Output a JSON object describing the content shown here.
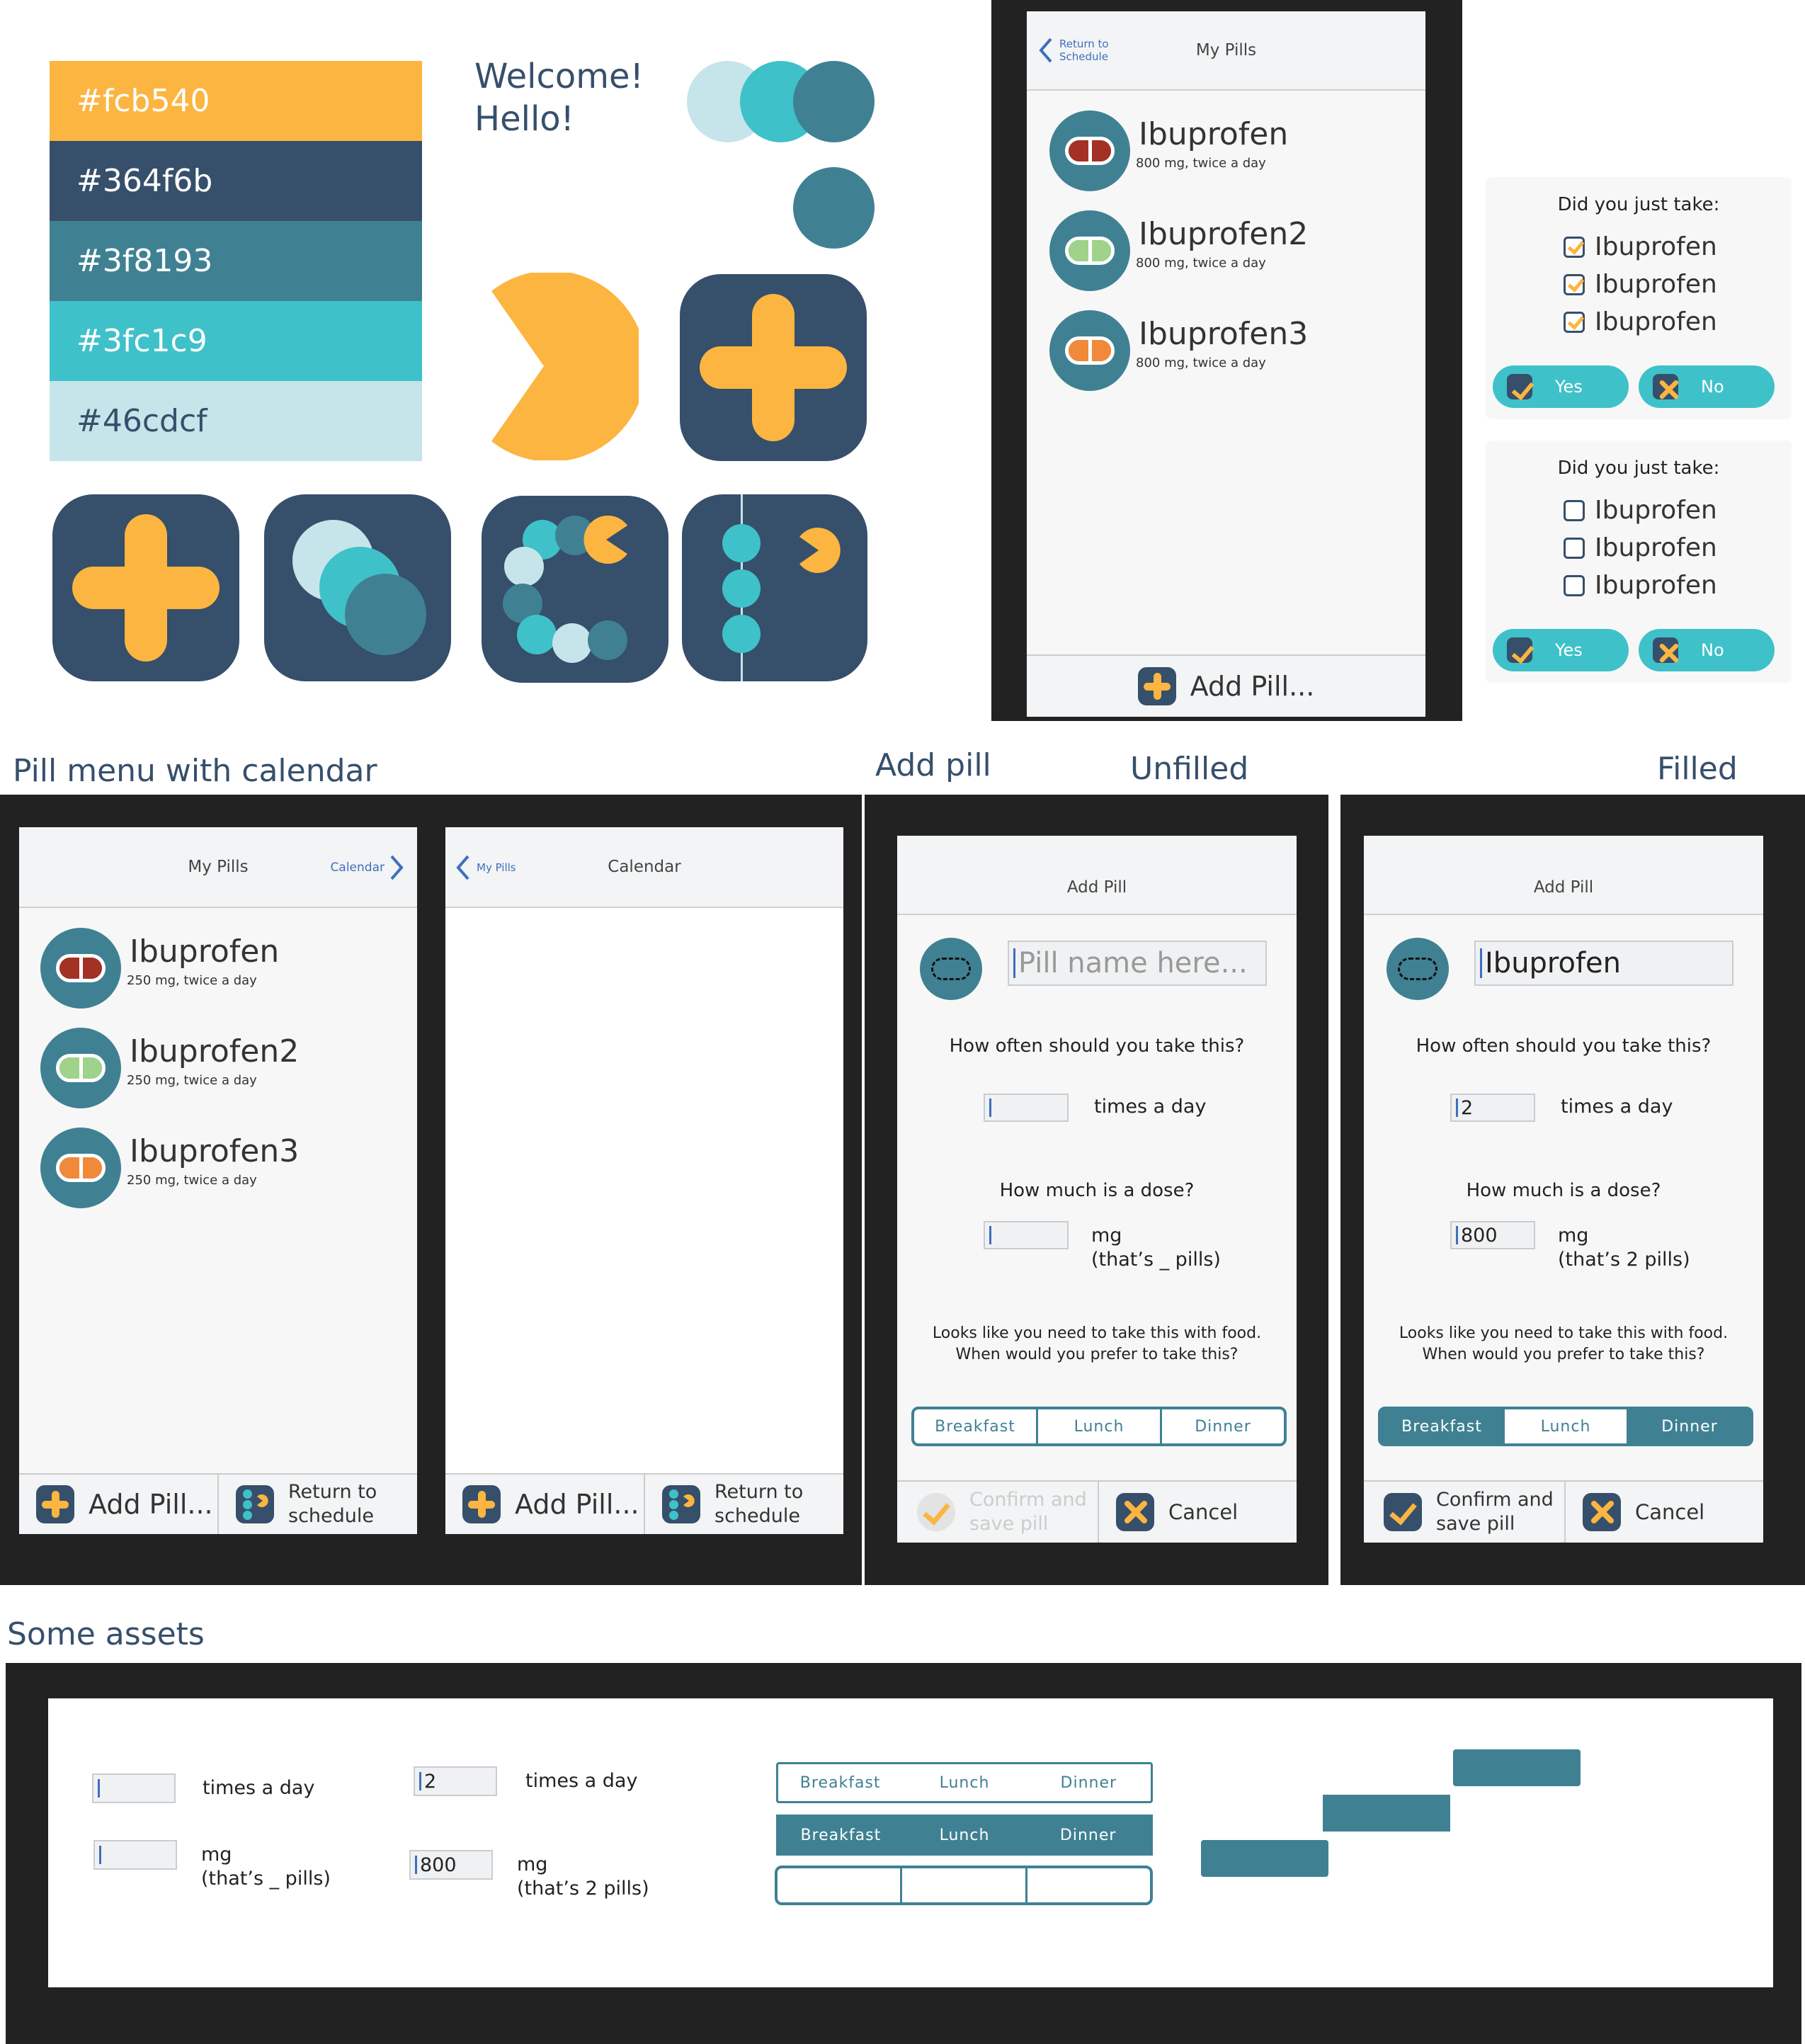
{
  "palette": {
    "swatches": [
      {
        "hex": "#fcb540",
        "label": "#fcb540",
        "text_color": "#ffffff"
      },
      {
        "hex": "#364f6b",
        "label": "#364f6b",
        "text_color": "#ffffff"
      },
      {
        "hex": "#3f8193",
        "label": "#3f8193",
        "text_color": "#ffffff"
      },
      {
        "hex": "#3fc1c9",
        "label": "#3fc1c9",
        "text_color": "#ffffff"
      },
      {
        "hex": "#c5e5ea",
        "label": "#46cdcf",
        "text_color": "#364f6b"
      }
    ]
  },
  "welcome": {
    "line1": "Welcome!",
    "line2": "Hello!"
  },
  "top_phone": {
    "back_label": "Return to Schedule",
    "title": "My Pills",
    "pills": [
      {
        "name": "Ibuprofen",
        "desc": "800 mg, twice a day",
        "color": "#a33224"
      },
      {
        "name": "Ibuprofen2",
        "desc": "800 mg, twice a day",
        "color": "#9fd28a"
      },
      {
        "name": "Ibuprofen3",
        "desc": "800 mg, twice a day",
        "color": "#f08a3a"
      }
    ],
    "add_label": "Add Pill..."
  },
  "prompts": [
    {
      "question": "Did you just take:",
      "items": [
        {
          "label": "Ibuprofen",
          "checked": true
        },
        {
          "label": "Ibuprofen",
          "checked": true
        },
        {
          "label": "Ibuprofen",
          "checked": true
        }
      ],
      "yes": "Yes",
      "no": "No"
    },
    {
      "question": "Did you just take:",
      "items": [
        {
          "label": "Ibuprofen",
          "checked": false
        },
        {
          "label": "Ibuprofen",
          "checked": false
        },
        {
          "label": "Ibuprofen",
          "checked": false
        }
      ],
      "yes": "Yes",
      "no": "No"
    }
  ],
  "sections": {
    "pill_menu": "Pill menu with calendar",
    "add_pill": "Add pill",
    "unfilled": "Unfilled",
    "filled": "Filled",
    "assets": "Some assets"
  },
  "menu_phone": {
    "title": "My Pills",
    "calendar_link": "Calendar",
    "pills": [
      {
        "name": "Ibuprofen",
        "desc": "250 mg, twice a day",
        "color": "#a33224"
      },
      {
        "name": "Ibuprofen2",
        "desc": "250 mg, twice a day",
        "color": "#9fd28a"
      },
      {
        "name": "Ibuprofen3",
        "desc": "250 mg, twice a day",
        "color": "#f08a3a"
      }
    ],
    "add_label": "Add Pill...",
    "return_label_1": "Return to",
    "return_label_2": "schedule"
  },
  "calendar_phone": {
    "back_label": "My Pills",
    "title": "Calendar",
    "add_label": "Add Pill...",
    "return_label_1": "Return to",
    "return_label_2": "schedule"
  },
  "add_unfilled": {
    "title": "Add Pill",
    "name_value": "",
    "name_placeholder": "Pill name here...",
    "freq_question": "How often should you take this?",
    "freq_value": "",
    "freq_unit": "times a day",
    "dose_question": "How much is a dose?",
    "dose_value": "",
    "dose_unit": "mg",
    "dose_note": "(that’s _ pills)",
    "food_line1": "Looks like you need to take this with food.",
    "food_line2": "When would you prefer to take this?",
    "meals": [
      "Breakfast",
      "Lunch",
      "Dinner"
    ],
    "confirm_1": "Confirm and",
    "confirm_2": "save pill",
    "cancel": "Cancel"
  },
  "add_filled": {
    "title": "Add Pill",
    "name_value": "Ibuprofen",
    "freq_question": "How often should you take this?",
    "freq_value": "2",
    "freq_unit": "times a day",
    "dose_question": "How much is a dose?",
    "dose_value": "800",
    "dose_unit": "mg",
    "dose_note": "(that’s 2 pills)",
    "food_line1": "Looks like you need to take this with food.",
    "food_line2": "When would you prefer to take this?",
    "meals": [
      "Breakfast",
      "Lunch",
      "Dinner"
    ],
    "selected_meal": "Lunch",
    "confirm_1": "Confirm and",
    "confirm_2": "save pill",
    "cancel": "Cancel"
  },
  "assets": {
    "times_a_day": "times a day",
    "freq_value": "2",
    "mg": "mg",
    "pills_unknown": "(that’s _ pills)",
    "dose_value": "800",
    "pills_two": "(that’s 2 pills)",
    "meals": [
      "Breakfast",
      "Lunch",
      "Dinner"
    ]
  }
}
